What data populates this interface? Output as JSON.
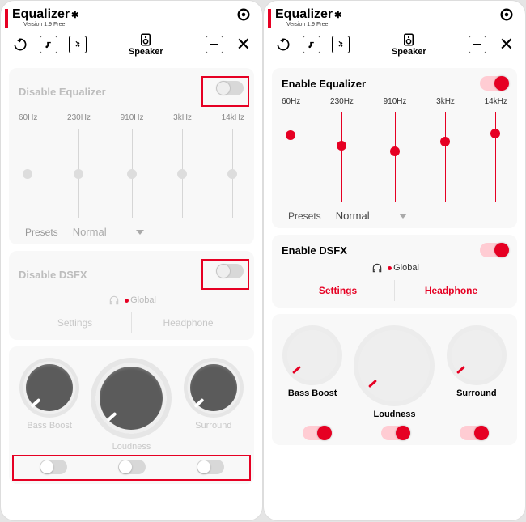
{
  "left": {
    "title": "Equalizer",
    "version": "Version 1.9 Free",
    "speaker": "Speaker",
    "eq": {
      "title": "Disable Equalizer",
      "freqs": [
        "60Hz",
        "230Hz",
        "910Hz",
        "3kHz",
        "14kHz"
      ],
      "presets_label": "Presets",
      "preset_value": "Normal"
    },
    "dsfx": {
      "title": "Disable DSFX",
      "global": "Global",
      "tab_settings": "Settings",
      "tab_headphone": "Headphone"
    },
    "knobs": {
      "bass": "Bass Boost",
      "loud": "Loudness",
      "surr": "Surround"
    }
  },
  "right": {
    "title": "Equalizer",
    "version": "Version 1.9 Free",
    "speaker": "Speaker",
    "eq": {
      "title": "Enable Equalizer",
      "freqs": [
        "60Hz",
        "230Hz",
        "910Hz",
        "3kHz",
        "14kHz"
      ],
      "slider_positions": [
        22,
        35,
        42,
        30,
        20
      ],
      "presets_label": "Presets",
      "preset_value": "Normal"
    },
    "dsfx": {
      "title": "Enable DSFX",
      "global": "Global",
      "tab_settings": "Settings",
      "tab_headphone": "Headphone"
    },
    "knobs": {
      "bass": "Bass Boost",
      "loud": "Loudness",
      "surr": "Surround"
    }
  }
}
